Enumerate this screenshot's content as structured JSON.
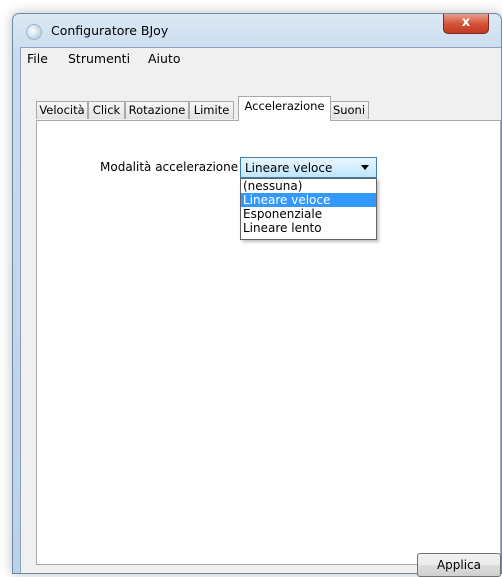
{
  "window": {
    "title": "Configuratore BJoy",
    "close_glyph": "x"
  },
  "menu": [
    {
      "label": "File"
    },
    {
      "label": "Strumenti"
    },
    {
      "label": "Aiuto"
    }
  ],
  "tabs": [
    {
      "label": "Velocità"
    },
    {
      "label": "Click"
    },
    {
      "label": "Rotazione"
    },
    {
      "label": "Limite"
    },
    {
      "label": "Accelerazione",
      "active": true
    },
    {
      "label": "Suoni"
    }
  ],
  "acceleration": {
    "label": "Modalità accelerazione",
    "selected": "Lineare veloce",
    "options": [
      "(nessuna)",
      "Lineare veloce",
      "Esponenziale",
      "Lineare lento"
    ],
    "highlighted_index": 1
  },
  "buttons": {
    "apply": "Applica"
  }
}
